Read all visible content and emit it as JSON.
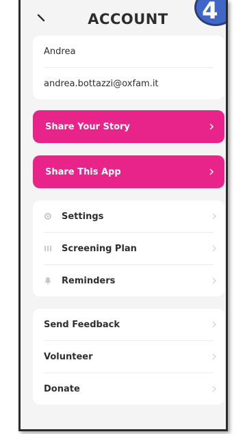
{
  "header": {
    "title": "ACCOUNT",
    "step_number": "4"
  },
  "profile": {
    "name": "Andrea",
    "email": "andrea.bottazzi@oxfam.it"
  },
  "actions": {
    "share_story": "Share Your Story",
    "share_app": "Share This App"
  },
  "menu": {
    "items": [
      {
        "label": "Settings",
        "icon": "gear-icon"
      },
      {
        "label": "Screening Plan",
        "icon": "map-icon"
      },
      {
        "label": "Reminders",
        "icon": "bell-icon"
      }
    ]
  },
  "support": {
    "items": [
      {
        "label": "Send Feedback"
      },
      {
        "label": "Volunteer"
      },
      {
        "label": "Donate"
      }
    ]
  },
  "colors": {
    "accent_pink": "#e8238a",
    "badge_blue": "#3f67c8",
    "background": "#f4f4f5"
  }
}
